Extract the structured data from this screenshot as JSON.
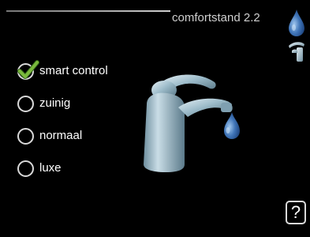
{
  "header": {
    "title": "comfortstand 2.2",
    "icons": [
      "water-drop-icon",
      "faucet-icon"
    ]
  },
  "options": [
    {
      "label": "smart control",
      "selected": true
    },
    {
      "label": "zuinig",
      "selected": false
    },
    {
      "label": "normaal",
      "selected": false
    },
    {
      "label": "luxe",
      "selected": false
    }
  ],
  "illustration": {
    "icon": "faucet-with-drop-icon"
  },
  "help": {
    "label": "?"
  },
  "colors": {
    "background": "#000000",
    "text": "#ffffff",
    "check": "#7ab83c",
    "faucet": "#8fb2c3",
    "drop": "#3f74b7"
  }
}
